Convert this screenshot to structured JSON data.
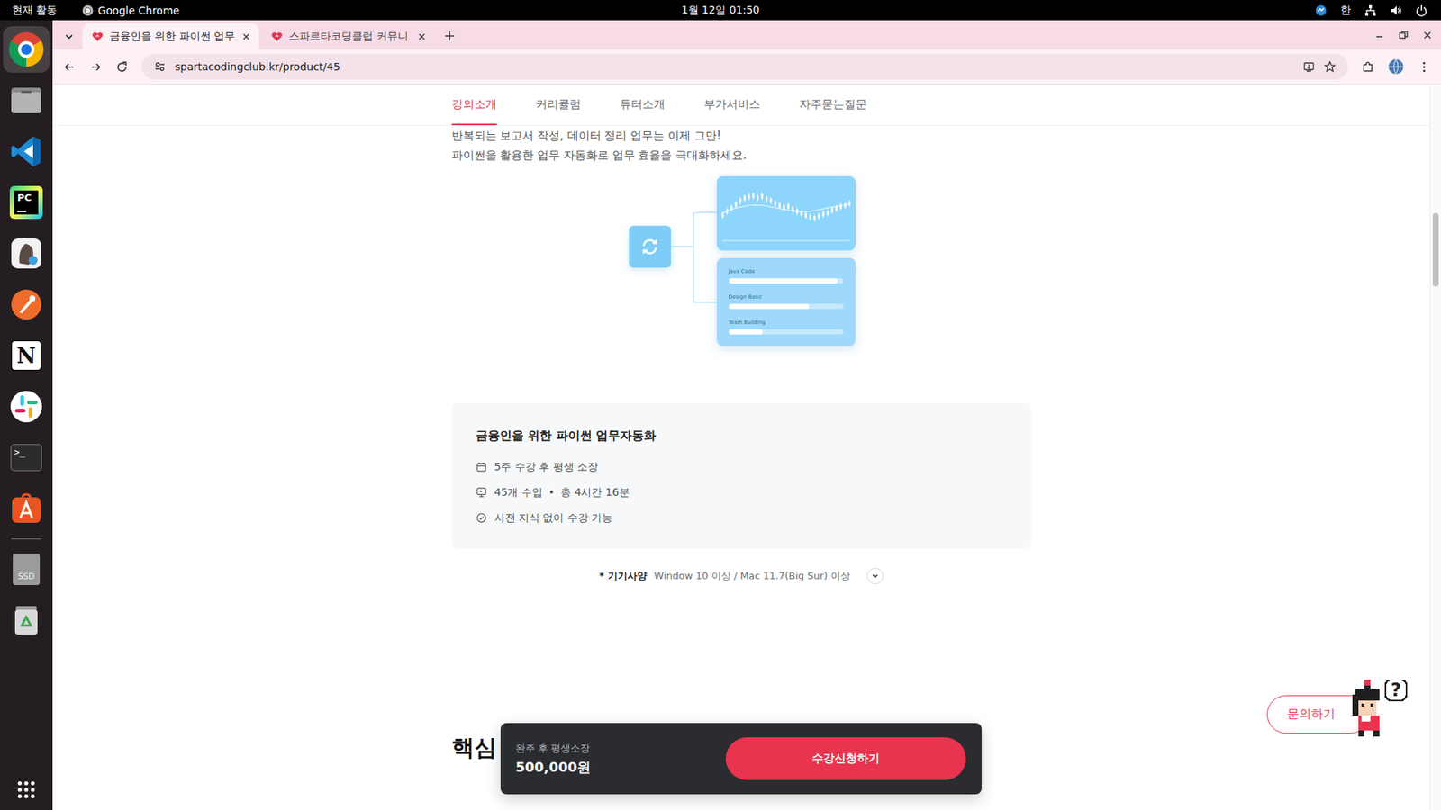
{
  "topbar": {
    "activities": "현재 활동",
    "app_name": "Google Chrome",
    "clock": "1월 12일 01:50",
    "input_method": "한"
  },
  "dock": {
    "apps": [
      {
        "kind": "chrome",
        "glyph": "",
        "running": true
      },
      {
        "kind": "files",
        "glyph": "",
        "running": false
      },
      {
        "kind": "vscode",
        "glyph": "",
        "running": false
      },
      {
        "kind": "pycharm",
        "glyph": "PC",
        "running": false
      },
      {
        "kind": "viewer",
        "glyph": "",
        "running": false
      },
      {
        "kind": "postman",
        "glyph": "",
        "running": false
      },
      {
        "kind": "notion",
        "glyph": "N",
        "running": false
      },
      {
        "kind": "slack",
        "glyph": "",
        "running": false
      },
      {
        "kind": "terminal",
        "glyph": ">_",
        "running": false
      },
      {
        "kind": "appcenter",
        "glyph": "",
        "running": false
      }
    ],
    "devices": [
      {
        "kind": "ssd",
        "glyph": "SSD",
        "running": false
      },
      {
        "kind": "trash",
        "glyph": "",
        "running": false
      }
    ]
  },
  "browser": {
    "tabs": [
      {
        "title": "금융인을 위한 파이썬 업무",
        "selected": true
      },
      {
        "title": "스파르타코딩클럽 커뮤니",
        "selected": false
      }
    ],
    "url": "spartacodingclub.kr/product/45",
    "bookmarked": false
  },
  "page": {
    "nav": [
      {
        "label": "강의소개",
        "selected": true
      },
      {
        "label": "커리큘럼",
        "selected": false
      },
      {
        "label": "튜터소개",
        "selected": false
      },
      {
        "label": "부가서비스",
        "selected": false
      },
      {
        "label": "자주묻는질문",
        "selected": false
      }
    ],
    "intro": [
      "반복되는 보고서 작성, 데이터 정리 업무는 이제 그만!",
      "파이썬을 활용한 업무 자동화로 업무 효율을 극대화하세요."
    ],
    "illustration": {
      "chart": {
        "candles": [
          40,
          48,
          55,
          62,
          70,
          75,
          78,
          80,
          76,
          79,
          74,
          70,
          64,
          60,
          56,
          58,
          52,
          48,
          44,
          40,
          36,
          34,
          38,
          42,
          45,
          50,
          54,
          58,
          60,
          64
        ],
        "trend": [
          45,
          50,
          55,
          58,
          60,
          61,
          60,
          58,
          55,
          52,
          50,
          48,
          47,
          48,
          50,
          53,
          56,
          58,
          60,
          62
        ]
      },
      "list": [
        {
          "label": "Java Code",
          "level": 0.95
        },
        {
          "label": "Design Basic",
          "level": 0.7
        },
        {
          "label": "Team Building",
          "level": 0.3
        }
      ]
    },
    "course": {
      "title": "금융인을 위한 파이썬 업무자동화",
      "facts": [
        {
          "kind": "period",
          "parts": [
            "5주 수강 후 평생 소장"
          ]
        },
        {
          "kind": "lessons",
          "parts": [
            "45개 수업",
            "•",
            "총 4시간 16분"
          ]
        },
        {
          "kind": "prereq",
          "parts": [
            "사전 지식 없이 수강 가능"
          ]
        }
      ]
    },
    "spec": {
      "label": "* 기기사양",
      "value": "Window 10 이상 / Mac 11.7(Big Sur) 이상",
      "expanded": false
    },
    "section_heading": "핵심",
    "purchase": {
      "caption": "완주 후 평생소장",
      "price": "500,000원",
      "button": "수강신청하기"
    },
    "inquiry": {
      "label": "문의하기",
      "mascot_mark": "?"
    }
  }
}
